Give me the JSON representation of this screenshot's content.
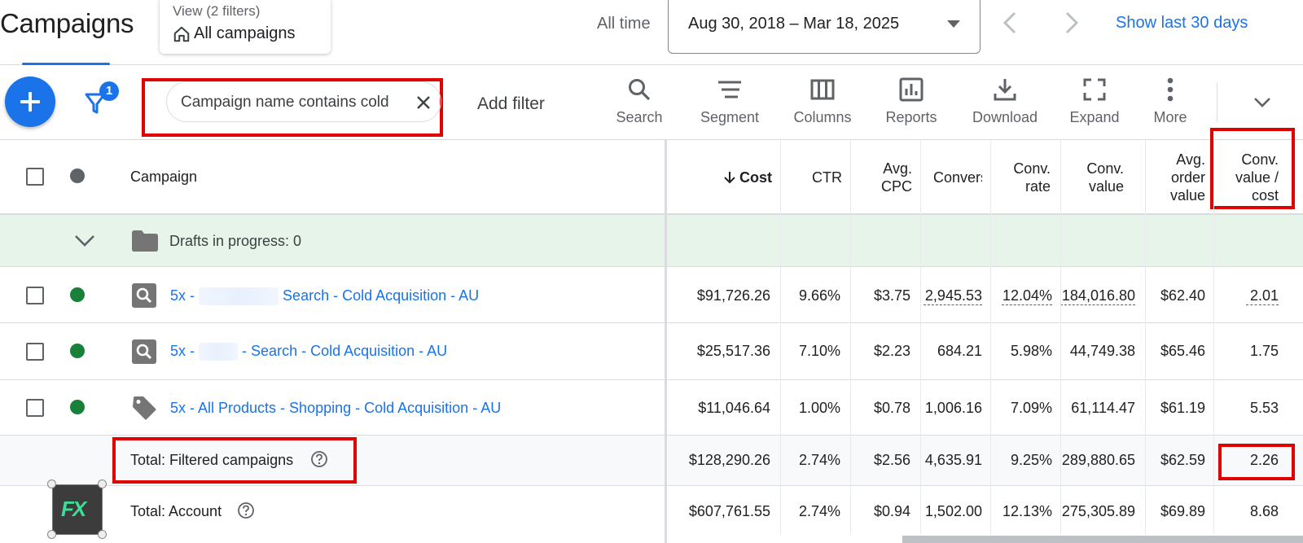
{
  "header": {
    "title": "Campaigns",
    "view_sub": "View (2 filters)",
    "view_main": "All campaigns",
    "all_time": "All time",
    "date_range": "Aug 30, 2018 – Mar 18, 2025",
    "show_last": "Show last 30 days"
  },
  "toolbar": {
    "filter_count": "1",
    "filter_chip": "Campaign name contains cold",
    "add_filter": "Add filter",
    "tools": {
      "search": "Search",
      "segment": "Segment",
      "columns": "Columns",
      "reports": "Reports",
      "download": "Download",
      "expand": "Expand",
      "more": "More"
    }
  },
  "table": {
    "headers": {
      "campaign": "Campaign",
      "cost": "Cost",
      "ctr": "CTR",
      "avg_cpc_1": "Avg.",
      "avg_cpc_2": "CPC",
      "conversions": "Convers",
      "conv_rate_1": "Conv.",
      "conv_rate_2": "rate",
      "conv_value_1": "Conv.",
      "conv_value_2": "value",
      "aov_1": "Avg.",
      "aov_2": "order",
      "aov_3": "value",
      "cvc_1": "Conv.",
      "cvc_2": "value /",
      "cvc_3": "cost"
    },
    "drafts": "Drafts in progress: 0",
    "rows": [
      {
        "name_a": "5x -",
        "name_b": "Search - Cold Acquisition - AU",
        "cost": "$91,726.26",
        "ctr": "9.66%",
        "cpc": "$3.75",
        "conv": "2,945.53",
        "rate": "12.04%",
        "value": "184,016.80",
        "aov": "$62.40",
        "vc": "2.01"
      },
      {
        "name_a": "5x -",
        "name_b": "- Search - Cold Acquisition - AU",
        "cost": "$25,517.36",
        "ctr": "7.10%",
        "cpc": "$2.23",
        "conv": "684.21",
        "rate": "5.98%",
        "value": "44,749.38",
        "aov": "$65.46",
        "vc": "1.75"
      },
      {
        "name_a": "5x - All Products - Shopping - Cold Acquisition - AU",
        "name_b": "",
        "cost": "$11,046.64",
        "ctr": "1.00%",
        "cpc": "$0.78",
        "conv": "1,006.16",
        "rate": "7.09%",
        "value": "61,114.47",
        "aov": "$61.19",
        "vc": "5.53"
      }
    ],
    "total_filtered": {
      "label": "Total: Filtered campaigns",
      "cost": "$128,290.26",
      "ctr": "2.74%",
      "cpc": "$2.56",
      "conv": "4,635.91",
      "rate": "9.25%",
      "value": "289,880.65",
      "aov": "$62.59",
      "vc": "2.26"
    },
    "total_account": {
      "label": "Total: Account",
      "cost": "$607,761.55",
      "ctr": "2.74%",
      "cpc": "$0.94",
      "conv": "1,502.00",
      "rate": "12.13%",
      "value": "275,305.89",
      "aov": "$69.89",
      "vc": "8.68"
    }
  },
  "logo": {
    "text": "FX"
  },
  "colors": {
    "accent": "#1a73e8",
    "highlight": "#e00000",
    "enabled": "#188038",
    "draft_bg": "#e6f4ea"
  }
}
